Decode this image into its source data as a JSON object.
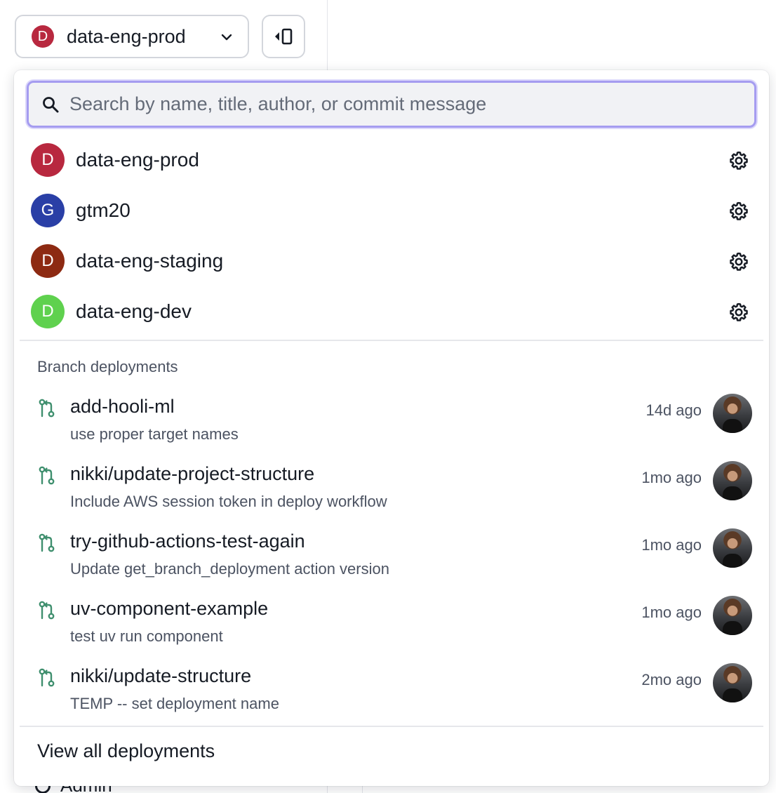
{
  "app": {
    "selected_deployment": "data-eng-prod",
    "selected_initial": "D",
    "selected_color": "#b8283f",
    "sidebar_admin_label": "Admin"
  },
  "search": {
    "placeholder": "Search by name, title, author, or commit message",
    "value": ""
  },
  "deployments": [
    {
      "name": "data-eng-prod",
      "initial": "D",
      "color": "#b8283f",
      "icon": "gear-icon"
    },
    {
      "name": "gtm20",
      "initial": "G",
      "color": "#2a3fa6",
      "icon": "gear-icon"
    },
    {
      "name": "data-eng-staging",
      "initial": "D",
      "color": "#8d2a12",
      "icon": "gear-icon"
    },
    {
      "name": "data-eng-dev",
      "initial": "D",
      "color": "#5fd14e",
      "icon": "gear-icon"
    }
  ],
  "branch_section": {
    "title": "Branch deployments",
    "items": [
      {
        "name": "add-hooli-ml",
        "message": "use proper target names",
        "time": "14d ago"
      },
      {
        "name": "nikki/update-project-structure",
        "message": "Include AWS session token in deploy workflow",
        "time": "1mo ago"
      },
      {
        "name": "try-github-actions-test-again",
        "message": "Update get_branch_deployment action version",
        "time": "1mo ago"
      },
      {
        "name": "uv-component-example",
        "message": "test uv run component",
        "time": "1mo ago"
      },
      {
        "name": "nikki/update-structure",
        "message": "TEMP -- set deployment name",
        "time": "2mo ago"
      }
    ]
  },
  "footer": {
    "view_all_label": "View all deployments"
  },
  "colors": {
    "accent_focus": "#a59cf0",
    "branch_icon": "#3f8f6e"
  }
}
